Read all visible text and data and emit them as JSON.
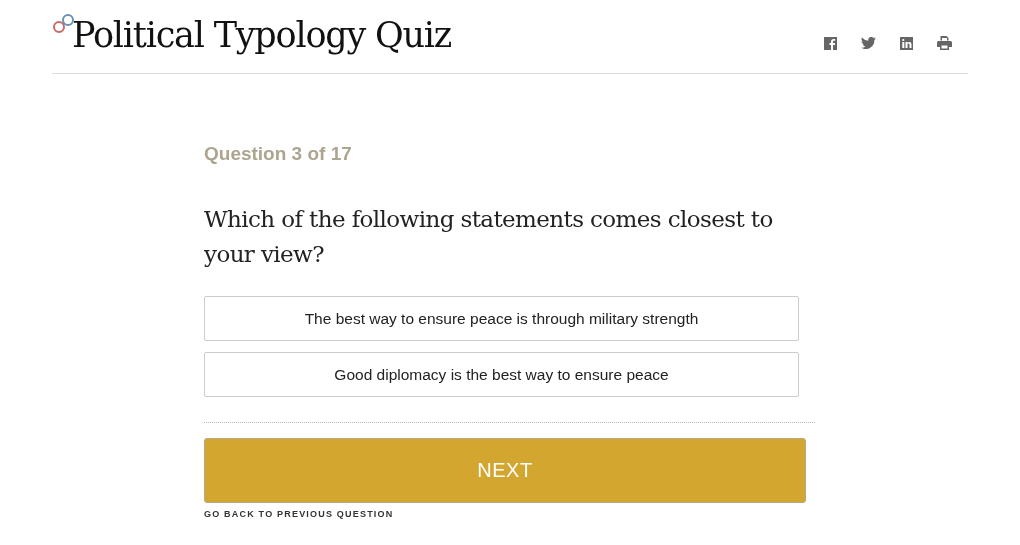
{
  "header": {
    "title": "Political Typology Quiz",
    "share_icons": [
      {
        "kind": "facebook"
      },
      {
        "kind": "twitter"
      },
      {
        "kind": "linkedin"
      },
      {
        "kind": "print"
      }
    ]
  },
  "quiz": {
    "progress": "Question 3 of 17",
    "question": "Which of the following statements comes closest to your view?",
    "options": [
      {
        "label": "The best way to ensure peace is through military strength",
        "selected": false
      },
      {
        "label": "Good diplomacy is the best way to ensure peace",
        "selected": false
      }
    ],
    "next_button": "NEXT",
    "back_link": "GO BACK TO PREVIOUS QUESTION"
  }
}
